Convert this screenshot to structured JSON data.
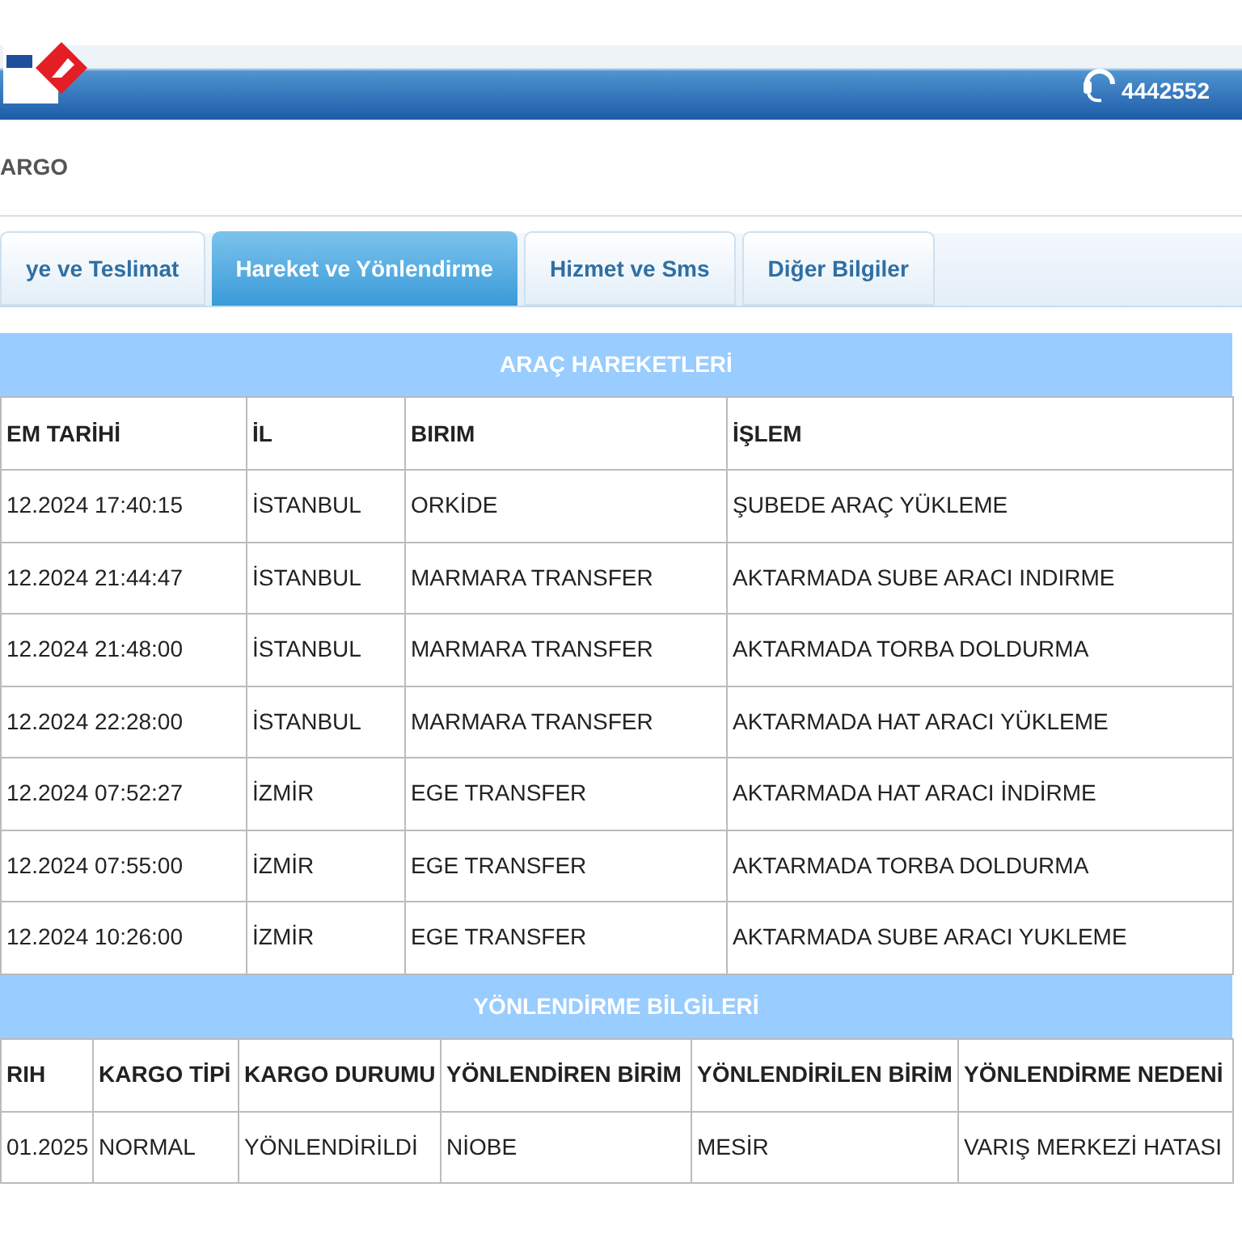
{
  "header": {
    "phone": "4442552"
  },
  "page_title": "ARGO",
  "tabs": [
    {
      "label": "ye ve Teslimat",
      "selected": false
    },
    {
      "label": "Hareket ve Yönlendirme",
      "selected": true
    },
    {
      "label": "Hizmet ve Sms",
      "selected": false
    },
    {
      "label": "Diğer Bilgiler",
      "selected": false
    }
  ],
  "movements": {
    "title": "ARAÇ HAREKETLERİ",
    "columns": [
      "EM TARİHİ",
      "İL",
      "BIRIM",
      "İŞLEM"
    ],
    "rows": [
      [
        "12.2024 17:40:15",
        "İSTANBUL",
        "ORKİDE",
        "ŞUBEDE ARAÇ YÜKLEME"
      ],
      [
        "12.2024 21:44:47",
        "İSTANBUL",
        "MARMARA TRANSFER",
        "AKTARMADA SUBE ARACI INDIRME"
      ],
      [
        "12.2024 21:48:00",
        "İSTANBUL",
        "MARMARA TRANSFER",
        "AKTARMADA TORBA DOLDURMA"
      ],
      [
        "12.2024 22:28:00",
        "İSTANBUL",
        "MARMARA TRANSFER",
        "AKTARMADA HAT ARACI YÜKLEME"
      ],
      [
        "12.2024 07:52:27",
        "İZMİR",
        "EGE TRANSFER",
        "AKTARMADA HAT ARACI İNDİRME"
      ],
      [
        "12.2024 07:55:00",
        "İZMİR",
        "EGE TRANSFER",
        "AKTARMADA TORBA DOLDURMA"
      ],
      [
        "12.2024 10:26:00",
        "İZMİR",
        "EGE TRANSFER",
        "AKTARMADA SUBE ARACI YUKLEME"
      ]
    ]
  },
  "redirection": {
    "title": "YÖNLENDİRME BİLGİLERİ",
    "columns": [
      "RIH",
      "KARGO TİPİ",
      "KARGO DURUMU",
      "YÖNLENDİREN BİRİM",
      "YÖNLENDİRİLEN BİRİM",
      "YÖNLENDİRME NEDENİ"
    ],
    "rows": [
      [
        "01.2025",
        "NORMAL",
        "YÖNLENDİRİLDİ",
        "NİOBE",
        "MESİR",
        "VARIŞ MERKEZİ HATASI"
      ]
    ]
  }
}
